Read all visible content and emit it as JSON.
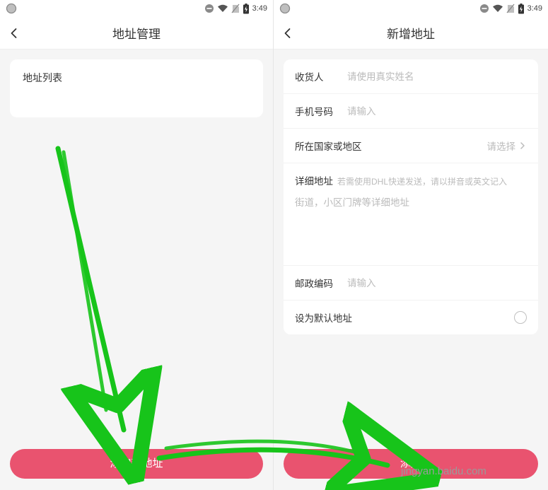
{
  "status": {
    "time": "3:49"
  },
  "left": {
    "title": "地址管理",
    "list_heading": "地址列表",
    "bottom_button": "添加新地址"
  },
  "right": {
    "title": "新增地址",
    "recipient_label": "收货人",
    "recipient_placeholder": "请使用真实姓名",
    "phone_label": "手机号码",
    "phone_placeholder": "请输入",
    "region_label": "所在国家或地区",
    "region_action": "请选择",
    "detail_label": "详细地址",
    "detail_hint": "若需使用DHL快递发送，请以拼音或英文记入",
    "detail_placeholder": "街道，小区门牌等详细地址",
    "postal_label": "邮政编码",
    "postal_placeholder": "请输入",
    "default_toggle_label": "设为默认地址",
    "bottom_button": "添加"
  },
  "watermark": "jingyan.baidu.com"
}
